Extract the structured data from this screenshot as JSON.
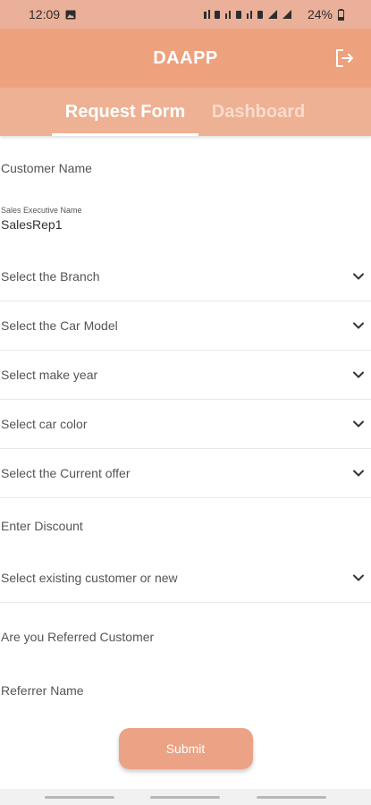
{
  "status_bar": {
    "time": "12:09",
    "battery": "24%"
  },
  "app_bar": {
    "title": "DAAPP",
    "logout_icon": "logout-icon"
  },
  "tabs": [
    {
      "label": "Request Form",
      "active": true
    },
    {
      "label": "Dashboard",
      "active": false
    }
  ],
  "form": {
    "customer_name_label": "Customer Name",
    "sales_exec_label": "Sales Executive Name",
    "sales_exec_value": "SalesRep1",
    "branch_label": "Select the Branch",
    "car_model_label": "Select the Car Model",
    "make_year_label": "Select make year",
    "car_color_label": "Select car color",
    "current_offer_label": "Select the Current offer",
    "discount_label": "Enter Discount",
    "existing_customer_label": "Select existing customer or new",
    "referred_label": "Are you Referred Customer",
    "referrer_name_label": "Referrer Name",
    "submit_label": "Submit"
  },
  "colors": {
    "app_bar": "#eea17d",
    "tab_bar": "#eeb193",
    "button": "#eba285"
  }
}
